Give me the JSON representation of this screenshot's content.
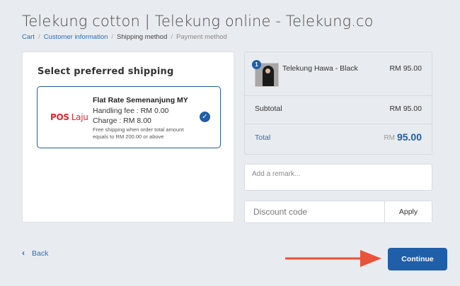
{
  "header": {
    "title": "Telekung cotton | Telekung online - Telekung.co"
  },
  "breadcrumb": {
    "cart": "Cart",
    "customer_information": "Customer information",
    "shipping_method": "Shipping method",
    "payment_method": "Payment method",
    "separator": "/"
  },
  "shipping": {
    "heading": "Select preferred shipping",
    "option": {
      "logo_pos": "POS",
      "logo_laju": "Laju",
      "title": "Flat Rate Semenanjung MY",
      "handling_fee": "Handling fee : RM 0.00",
      "charge": "Charge : RM 8.00",
      "note": "Free shipping when order total amount equals to RM 200.00 or above",
      "selected": true,
      "check_icon": "✓"
    }
  },
  "summary": {
    "item": {
      "quantity": "1",
      "name": "Telekung Hawa - Black",
      "price": "RM 95.00"
    },
    "subtotal_label": "Subtotal",
    "subtotal_value": "RM 95.00",
    "total_label": "Total",
    "total_currency": "RM",
    "total_value": "95.00"
  },
  "remark": {
    "placeholder": "Add a remark...",
    "value": ""
  },
  "discount": {
    "placeholder": "Discount code",
    "value": "",
    "apply_label": "Apply"
  },
  "footer": {
    "back_icon": "‹",
    "back_label": "Back",
    "continue_label": "Continue"
  },
  "colors": {
    "accent": "#1f5ea8",
    "link": "#2a6ebb",
    "annotation_arrow": "#e8533a",
    "pos_laju_red": "#e5252b",
    "background": "#e8ebef"
  }
}
